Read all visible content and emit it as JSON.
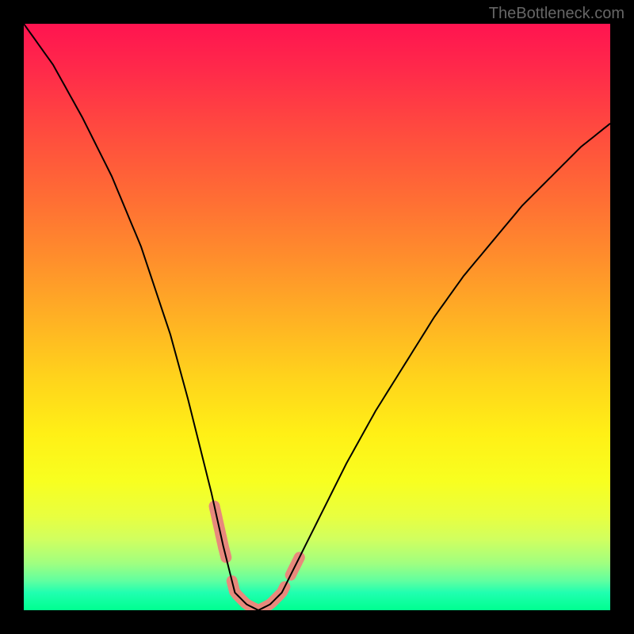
{
  "watermark": "TheBottleneck.com",
  "chart_data": {
    "type": "line",
    "title": "",
    "xlabel": "",
    "ylabel": "",
    "x_range": [
      0,
      100
    ],
    "y_range": [
      0,
      100
    ],
    "description": "V-shaped bottleneck curve over a vertical gradient from red (top/high bottleneck) to green (bottom/optimal). The curve descends steeply from the top-left, reaches a minimum near x≈36 at y≈0, stays near zero to x≈44, then rises toward the upper-right. Salmon-colored segments highlight the region near the minimum where the curve meets the green band.",
    "series": [
      {
        "name": "bottleneck-curve",
        "x": [
          0,
          5,
          10,
          15,
          20,
          25,
          28,
          30,
          32,
          34,
          36,
          38,
          40,
          42,
          44,
          46,
          50,
          55,
          60,
          65,
          70,
          75,
          80,
          85,
          90,
          95,
          100
        ],
        "values": [
          100,
          93,
          84,
          74,
          62,
          47,
          36,
          28,
          20,
          11,
          3,
          1,
          0,
          1,
          3,
          7,
          15,
          25,
          34,
          42,
          50,
          57,
          63,
          69,
          74,
          79,
          83
        ]
      }
    ],
    "highlight_ranges": [
      {
        "x_start": 32.5,
        "x_end": 34.5
      },
      {
        "x_start": 35.5,
        "x_end": 44.5
      },
      {
        "x_start": 45.5,
        "x_end": 47.0
      }
    ],
    "gradient_stops": [
      {
        "pct": 0,
        "color": "#ff1450"
      },
      {
        "pct": 50,
        "color": "#ffb024"
      },
      {
        "pct": 78,
        "color": "#f8ff20"
      },
      {
        "pct": 100,
        "color": "#00ff90"
      }
    ]
  }
}
